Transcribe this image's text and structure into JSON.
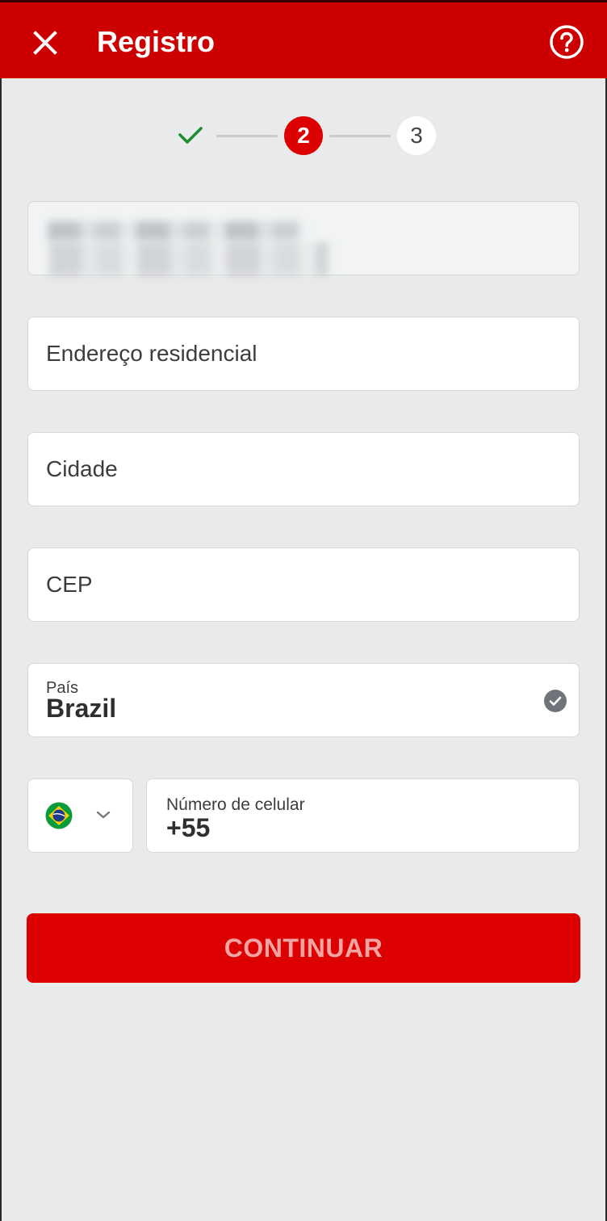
{
  "header": {
    "title": "Registro",
    "background_color": "#cc0000"
  },
  "stepper": {
    "completed_icon": "check-icon",
    "current_step": "2",
    "next_step": "3",
    "active_color": "#dd0000"
  },
  "form": {
    "full_name": {
      "value": "",
      "note": "blurred content"
    },
    "address": {
      "placeholder": "Endereço residencial"
    },
    "city": {
      "placeholder": "Cidade"
    },
    "postal_code": {
      "placeholder": "CEP"
    },
    "country": {
      "label": "País",
      "value": "Brazil",
      "status_icon": "check-circle-icon"
    },
    "phone": {
      "country_flag": "brazil-flag-icon",
      "label": "Número de celular",
      "value": "+55"
    }
  },
  "actions": {
    "continue_label": "CONTINUAR"
  },
  "icons": {
    "close": "close-icon",
    "help": "help-icon",
    "dropdown": "chevron-down-icon"
  }
}
